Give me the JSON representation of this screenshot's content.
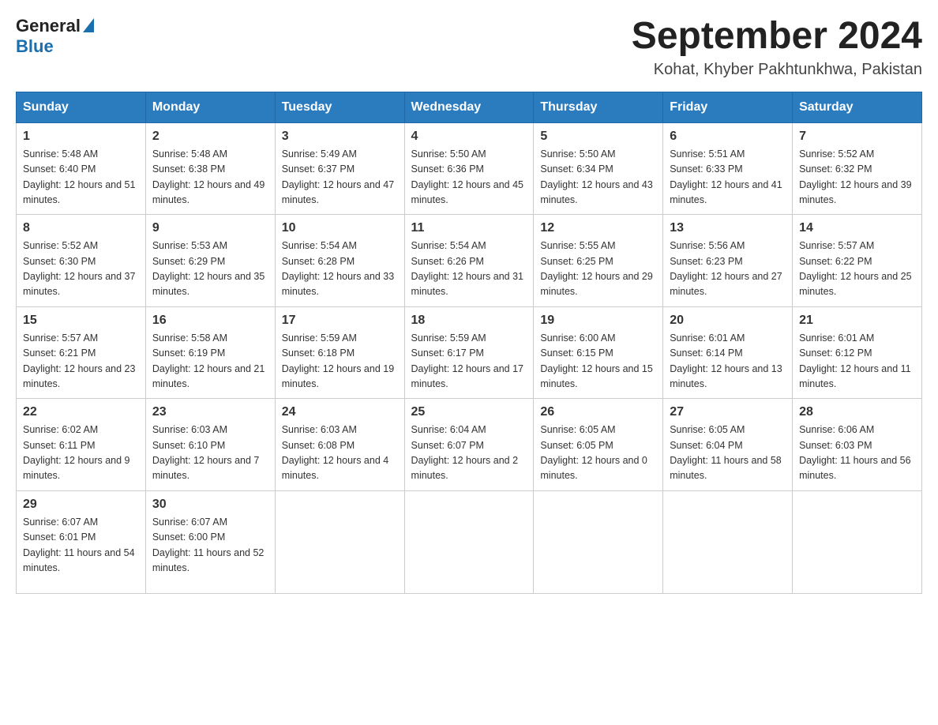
{
  "header": {
    "logo_general": "General",
    "logo_blue": "Blue",
    "month_year": "September 2024",
    "location": "Kohat, Khyber Pakhtunkhwa, Pakistan"
  },
  "days_of_week": [
    "Sunday",
    "Monday",
    "Tuesday",
    "Wednesday",
    "Thursday",
    "Friday",
    "Saturday"
  ],
  "weeks": [
    [
      {
        "day": "1",
        "sunrise": "Sunrise: 5:48 AM",
        "sunset": "Sunset: 6:40 PM",
        "daylight": "Daylight: 12 hours and 51 minutes."
      },
      {
        "day": "2",
        "sunrise": "Sunrise: 5:48 AM",
        "sunset": "Sunset: 6:38 PM",
        "daylight": "Daylight: 12 hours and 49 minutes."
      },
      {
        "day": "3",
        "sunrise": "Sunrise: 5:49 AM",
        "sunset": "Sunset: 6:37 PM",
        "daylight": "Daylight: 12 hours and 47 minutes."
      },
      {
        "day": "4",
        "sunrise": "Sunrise: 5:50 AM",
        "sunset": "Sunset: 6:36 PM",
        "daylight": "Daylight: 12 hours and 45 minutes."
      },
      {
        "day": "5",
        "sunrise": "Sunrise: 5:50 AM",
        "sunset": "Sunset: 6:34 PM",
        "daylight": "Daylight: 12 hours and 43 minutes."
      },
      {
        "day": "6",
        "sunrise": "Sunrise: 5:51 AM",
        "sunset": "Sunset: 6:33 PM",
        "daylight": "Daylight: 12 hours and 41 minutes."
      },
      {
        "day": "7",
        "sunrise": "Sunrise: 5:52 AM",
        "sunset": "Sunset: 6:32 PM",
        "daylight": "Daylight: 12 hours and 39 minutes."
      }
    ],
    [
      {
        "day": "8",
        "sunrise": "Sunrise: 5:52 AM",
        "sunset": "Sunset: 6:30 PM",
        "daylight": "Daylight: 12 hours and 37 minutes."
      },
      {
        "day": "9",
        "sunrise": "Sunrise: 5:53 AM",
        "sunset": "Sunset: 6:29 PM",
        "daylight": "Daylight: 12 hours and 35 minutes."
      },
      {
        "day": "10",
        "sunrise": "Sunrise: 5:54 AM",
        "sunset": "Sunset: 6:28 PM",
        "daylight": "Daylight: 12 hours and 33 minutes."
      },
      {
        "day": "11",
        "sunrise": "Sunrise: 5:54 AM",
        "sunset": "Sunset: 6:26 PM",
        "daylight": "Daylight: 12 hours and 31 minutes."
      },
      {
        "day": "12",
        "sunrise": "Sunrise: 5:55 AM",
        "sunset": "Sunset: 6:25 PM",
        "daylight": "Daylight: 12 hours and 29 minutes."
      },
      {
        "day": "13",
        "sunrise": "Sunrise: 5:56 AM",
        "sunset": "Sunset: 6:23 PM",
        "daylight": "Daylight: 12 hours and 27 minutes."
      },
      {
        "day": "14",
        "sunrise": "Sunrise: 5:57 AM",
        "sunset": "Sunset: 6:22 PM",
        "daylight": "Daylight: 12 hours and 25 minutes."
      }
    ],
    [
      {
        "day": "15",
        "sunrise": "Sunrise: 5:57 AM",
        "sunset": "Sunset: 6:21 PM",
        "daylight": "Daylight: 12 hours and 23 minutes."
      },
      {
        "day": "16",
        "sunrise": "Sunrise: 5:58 AM",
        "sunset": "Sunset: 6:19 PM",
        "daylight": "Daylight: 12 hours and 21 minutes."
      },
      {
        "day": "17",
        "sunrise": "Sunrise: 5:59 AM",
        "sunset": "Sunset: 6:18 PM",
        "daylight": "Daylight: 12 hours and 19 minutes."
      },
      {
        "day": "18",
        "sunrise": "Sunrise: 5:59 AM",
        "sunset": "Sunset: 6:17 PM",
        "daylight": "Daylight: 12 hours and 17 minutes."
      },
      {
        "day": "19",
        "sunrise": "Sunrise: 6:00 AM",
        "sunset": "Sunset: 6:15 PM",
        "daylight": "Daylight: 12 hours and 15 minutes."
      },
      {
        "day": "20",
        "sunrise": "Sunrise: 6:01 AM",
        "sunset": "Sunset: 6:14 PM",
        "daylight": "Daylight: 12 hours and 13 minutes."
      },
      {
        "day": "21",
        "sunrise": "Sunrise: 6:01 AM",
        "sunset": "Sunset: 6:12 PM",
        "daylight": "Daylight: 12 hours and 11 minutes."
      }
    ],
    [
      {
        "day": "22",
        "sunrise": "Sunrise: 6:02 AM",
        "sunset": "Sunset: 6:11 PM",
        "daylight": "Daylight: 12 hours and 9 minutes."
      },
      {
        "day": "23",
        "sunrise": "Sunrise: 6:03 AM",
        "sunset": "Sunset: 6:10 PM",
        "daylight": "Daylight: 12 hours and 7 minutes."
      },
      {
        "day": "24",
        "sunrise": "Sunrise: 6:03 AM",
        "sunset": "Sunset: 6:08 PM",
        "daylight": "Daylight: 12 hours and 4 minutes."
      },
      {
        "day": "25",
        "sunrise": "Sunrise: 6:04 AM",
        "sunset": "Sunset: 6:07 PM",
        "daylight": "Daylight: 12 hours and 2 minutes."
      },
      {
        "day": "26",
        "sunrise": "Sunrise: 6:05 AM",
        "sunset": "Sunset: 6:05 PM",
        "daylight": "Daylight: 12 hours and 0 minutes."
      },
      {
        "day": "27",
        "sunrise": "Sunrise: 6:05 AM",
        "sunset": "Sunset: 6:04 PM",
        "daylight": "Daylight: 11 hours and 58 minutes."
      },
      {
        "day": "28",
        "sunrise": "Sunrise: 6:06 AM",
        "sunset": "Sunset: 6:03 PM",
        "daylight": "Daylight: 11 hours and 56 minutes."
      }
    ],
    [
      {
        "day": "29",
        "sunrise": "Sunrise: 6:07 AM",
        "sunset": "Sunset: 6:01 PM",
        "daylight": "Daylight: 11 hours and 54 minutes."
      },
      {
        "day": "30",
        "sunrise": "Sunrise: 6:07 AM",
        "sunset": "Sunset: 6:00 PM",
        "daylight": "Daylight: 11 hours and 52 minutes."
      },
      null,
      null,
      null,
      null,
      null
    ]
  ]
}
